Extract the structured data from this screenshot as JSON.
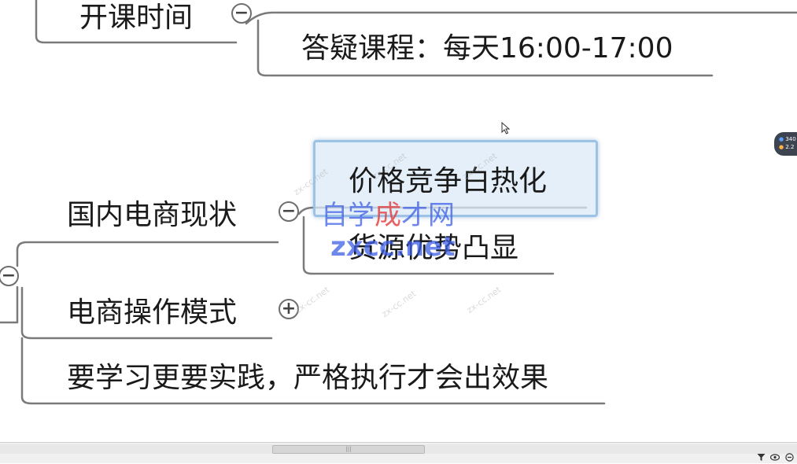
{
  "topics": {
    "kaike_shijian": "开课时间",
    "dayi_kecheng": "答疑课程：每天16:00-17:00",
    "jiage_jingzheng": "价格竞争白热化",
    "guonei_dianshang": "国内电商现状",
    "huoyuan_youshi": "货源优势凸显",
    "dianshang_caozuo": "电商操作模式",
    "yao_xuexi": "要学习更要实践，严格执行才会出效果"
  },
  "toggles": {
    "collapse_symbol": "−",
    "expand_symbol": "+"
  },
  "watermark": {
    "cn_part1": "自学",
    "cn_part2": "成",
    "cn_part3": "才网",
    "en": "zxcc.net",
    "faint": "zx-cc.net"
  },
  "stats_widget": {
    "line1": "340",
    "line2": "2.2"
  },
  "colors": {
    "branch_line": "#7a7a7a",
    "selection_border": "#9cc3e6",
    "selection_fill": "#dbeaf7",
    "watermark_blue": "#3e5fe6",
    "watermark_red": "#e13c3c"
  },
  "icons": {
    "filter": "filter-icon",
    "eye": "eye-icon",
    "zoom_out": "zoom-out-icon",
    "cursor": "mouse-cursor-icon"
  }
}
